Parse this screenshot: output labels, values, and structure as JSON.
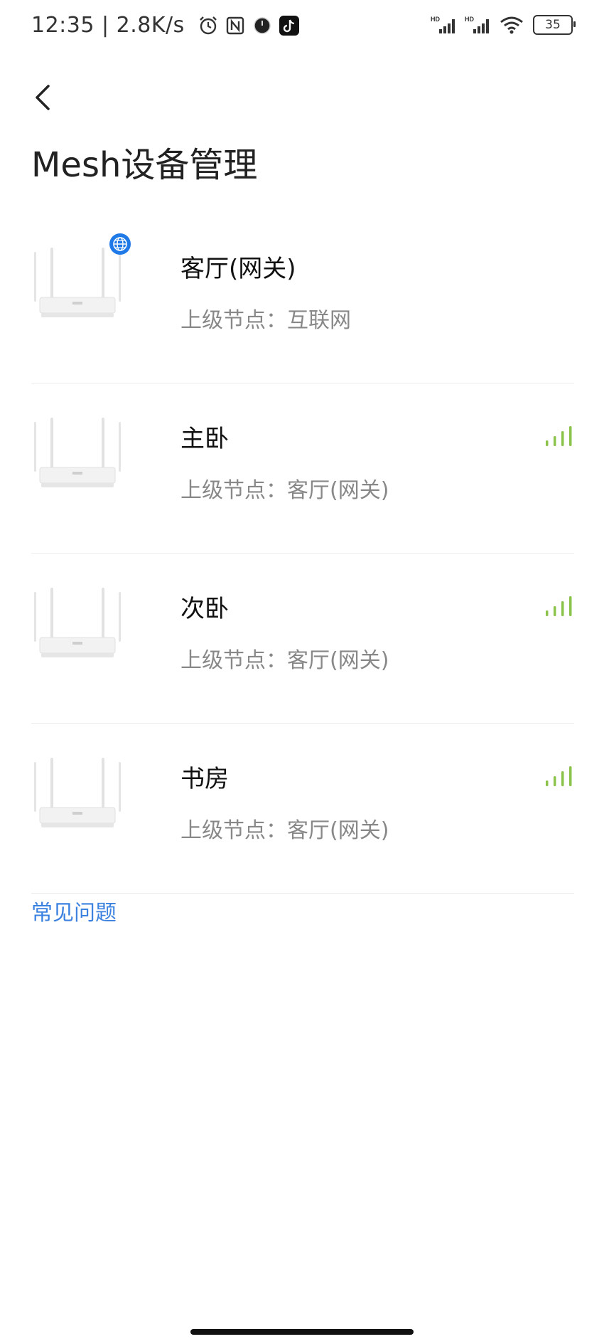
{
  "status_bar": {
    "time": "12:35 | 2.8K/s",
    "battery": "35",
    "icons": [
      "alarm-icon",
      "nfc-icon",
      "circle-app-icon",
      "tiktok-icon",
      "hd-cell-signal-icon",
      "hd-cell-signal-icon",
      "wifi-icon",
      "battery-icon"
    ]
  },
  "header": {
    "back_icon": "chevron-left-icon",
    "title": "Mesh设备管理"
  },
  "devices": [
    {
      "name": "客厅(网关)",
      "parent": "上级节点：互联网",
      "badge": "globe-icon",
      "signal": null
    },
    {
      "name": "主卧",
      "parent": "上级节点：客厅(网关)",
      "badge": null,
      "signal": "signal-strength-icon"
    },
    {
      "name": "次卧",
      "parent": "上级节点：客厅(网关)",
      "badge": null,
      "signal": "signal-strength-icon"
    },
    {
      "name": "书房",
      "parent": "上级节点：客厅(网关)",
      "badge": null,
      "signal": "signal-strength-icon"
    }
  ],
  "faq": {
    "label": "常见问题"
  },
  "colors": {
    "accent": "#3b82e0",
    "signal": "#8bc34a",
    "globe": "#1f7ae8",
    "divider": "#ececec"
  }
}
